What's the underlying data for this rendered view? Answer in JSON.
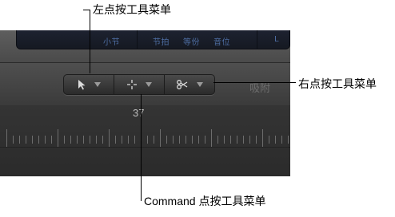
{
  "inspector": {
    "labels": [
      "小节",
      "节拍",
      "等份",
      "音位",
      "L"
    ]
  },
  "toolbar": {
    "buttons": [
      {
        "name": "pointer-tool",
        "icon": "arrow-pointer-icon"
      },
      {
        "name": "marquee-tool",
        "icon": "crosshair-icon"
      },
      {
        "name": "scissors-tool",
        "icon": "scissors-icon"
      }
    ],
    "cut_label": "吸附"
  },
  "ruler": {
    "bar_number": "37"
  },
  "callouts": {
    "left": "左点按工具菜单",
    "right": "右点按工具菜单",
    "command": "Command 点按工具菜单"
  }
}
